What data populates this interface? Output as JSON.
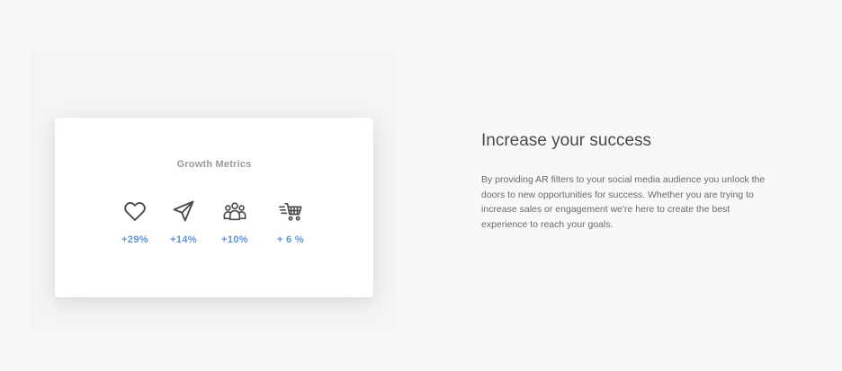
{
  "card": {
    "title": "Growth Metrics",
    "metrics": [
      {
        "icon": "heart-icon",
        "value": "+29%"
      },
      {
        "icon": "send-icon",
        "value": "+14%"
      },
      {
        "icon": "users-group-icon",
        "value": "+10%"
      },
      {
        "icon": "cart-fast-icon",
        "value": "+ 6 %"
      }
    ]
  },
  "info": {
    "headline": "Increase your success",
    "paragraph": "By providing AR filters to your social media audience you unlock the doors to new opportunities for success. Whether you are trying to increase sales or engagement we're here to create the best experience to reach your goals."
  },
  "colors": {
    "background": "#f8f8f9",
    "metric_value": "#5f95d8",
    "icon_stroke": "#4a4a4a"
  }
}
